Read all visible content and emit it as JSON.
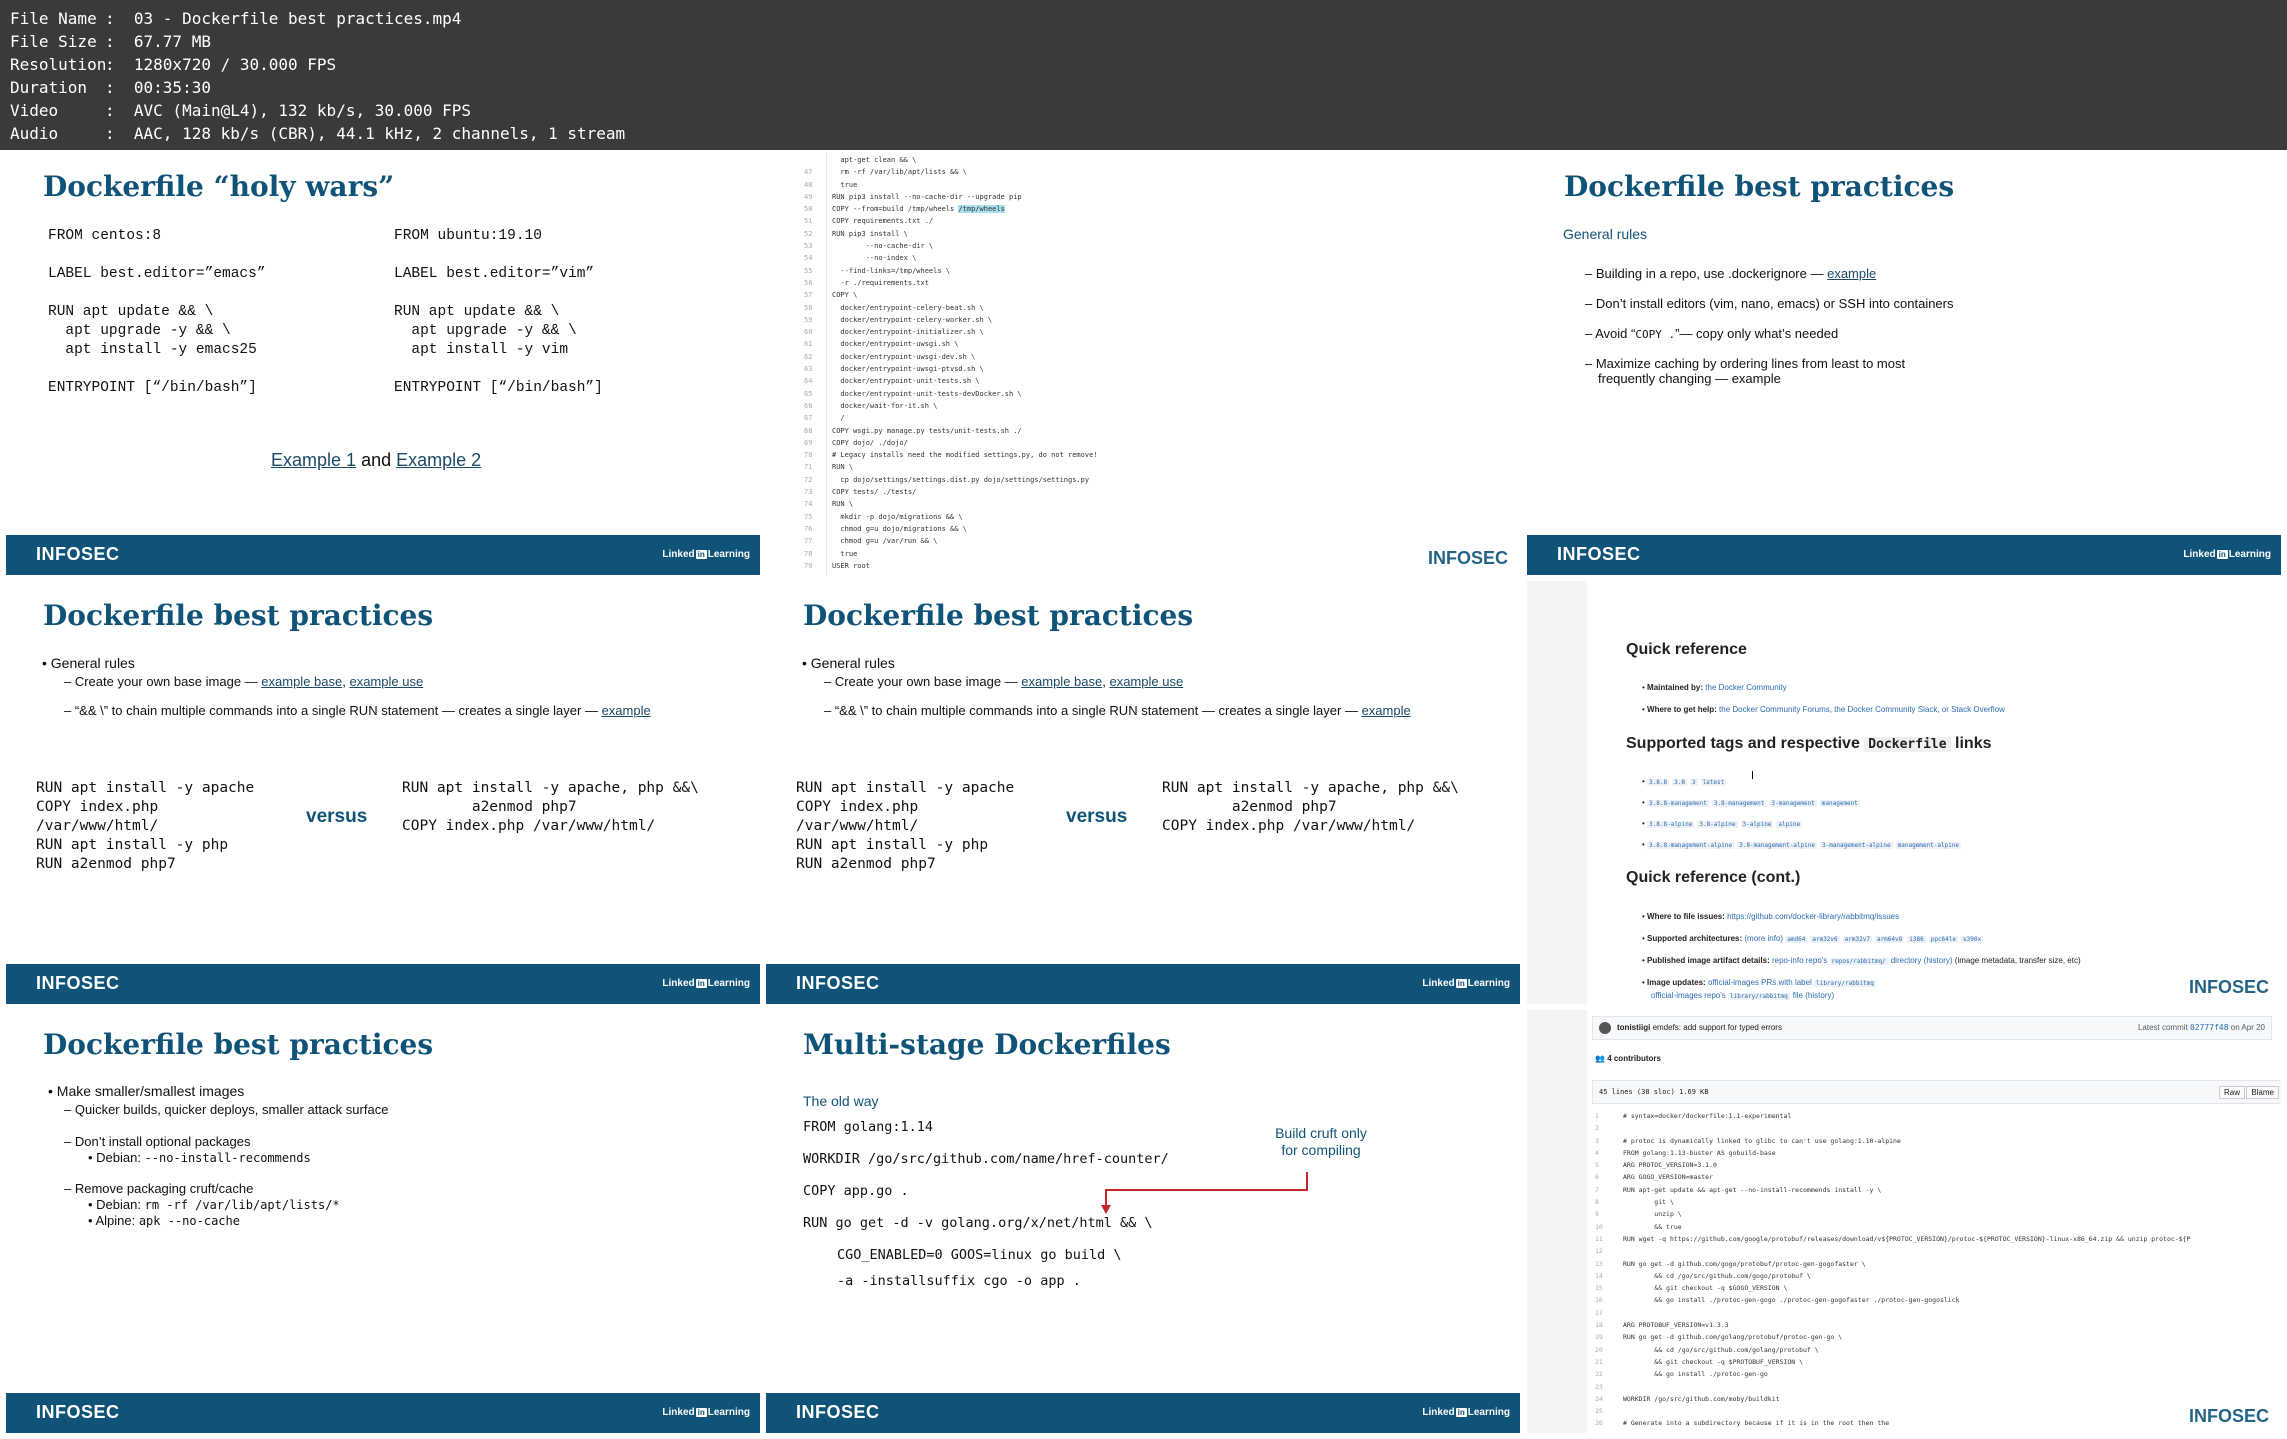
{
  "meta": [
    {
      "key": "File Name",
      "value": "03 - Dockerfile best practices.mp4"
    },
    {
      "key": "File Size",
      "value": "67.77 MB"
    },
    {
      "key": "Resolution",
      "value": "1280x720 / 30.000 FPS"
    },
    {
      "key": "Duration",
      "value": "00:35:30"
    },
    {
      "key": "Video",
      "value": "AVC (Main@L4), 132 kb/s, 30.000 FPS"
    },
    {
      "key": "Audio",
      "value": "AAC, 128 kb/s (CBR), 44.1 kHz, 2 channels, 1 stream"
    }
  ],
  "footer": {
    "brand": "INFOSEC",
    "linked": "Linked",
    "in": "in",
    "learning": "Learning"
  },
  "tile1": {
    "title": "Dockerfile “holy wars”",
    "left": "FROM centos:8\n\nLABEL best.editor=”emacs”\n\nRUN apt update && \\\n  apt upgrade -y && \\\n  apt install -y emacs25\n\nENTRYPOINT [“/bin/bash”]",
    "right": "FROM ubuntu:19.10\n\nLABEL best.editor=”vim”\n\nRUN apt update && \\\n  apt upgrade -y && \\\n  apt install -y vim\n\nENTRYPOINT [“/bin/bash”]",
    "link1": "Example 1",
    "and": "and",
    "link2": "Example 2"
  },
  "tile2": {
    "lines": [
      [
        "",
        "  apt-get clean && \\"
      ],
      [
        "47",
        "  rm -rf /var/lib/apt/lists && \\"
      ],
      [
        "48",
        "  true"
      ],
      [
        "49",
        "RUN pip3 install --no-cache-dir --upgrade pip"
      ],
      [
        "50",
        "COPY --from=build /tmp/wheels /tmp/wheels"
      ],
      [
        "51",
        "COPY requirements.txt ./"
      ],
      [
        "52",
        "RUN pip3 install \\"
      ],
      [
        "53",
        "        --no-cache-dir \\"
      ],
      [
        "54",
        "        --no-index \\"
      ],
      [
        "55",
        "  --find-links=/tmp/wheels \\"
      ],
      [
        "56",
        "  -r ./requirements.txt"
      ],
      [
        "57",
        "COPY \\"
      ],
      [
        "58",
        "  docker/entrypoint-celery-beat.sh \\"
      ],
      [
        "59",
        "  docker/entrypoint-celery-worker.sh \\"
      ],
      [
        "60",
        "  docker/entrypoint-initializer.sh \\"
      ],
      [
        "61",
        "  docker/entrypoint-uwsgi.sh \\"
      ],
      [
        "62",
        "  docker/entrypoint-uwsgi-dev.sh \\"
      ],
      [
        "63",
        "  docker/entrypoint-uwsgi-ptvsd.sh \\"
      ],
      [
        "64",
        "  docker/entrypoint-unit-tests.sh \\"
      ],
      [
        "65",
        "  docker/entrypoint-unit-tests-devDocker.sh \\"
      ],
      [
        "66",
        "  docker/wait-for-it.sh \\"
      ],
      [
        "67",
        "  /"
      ],
      [
        "68",
        "COPY wsgi.py manage.py tests/unit-tests.sh ./"
      ],
      [
        "69",
        "COPY dojo/ ./dojo/"
      ],
      [
        "70",
        "# Legacy installs need the modified settings.py, do not remove!"
      ],
      [
        "71",
        "RUN \\"
      ],
      [
        "72",
        "  cp dojo/settings/settings.dist.py dojo/settings/settings.py"
      ],
      [
        "73",
        "COPY tests/ ./tests/"
      ],
      [
        "74",
        "RUN \\"
      ],
      [
        "75",
        "  mkdir -p dojo/migrations && \\"
      ],
      [
        "76",
        "  chmod g=u dojo/migrations && \\"
      ],
      [
        "77",
        "  chmod g=u /var/run && \\"
      ],
      [
        "78",
        "  true"
      ],
      [
        "79",
        "USER root"
      ]
    ],
    "watermark": "INFOSEC"
  },
  "tile3": {
    "title": "Dockerfile best practices",
    "subtitle": "General rules",
    "b1": "Building in a repo, use .dockerignore — ",
    "b1link": "example",
    "b2": "Don’t install editors (vim, nano, emacs) or SSH into containers",
    "b3a": "Avoid “",
    "b3code": "COPY .",
    "b3b": "”— copy only what’s needed",
    "b4a": "Maximize caching by ordering lines from least to most",
    "b4b": "frequently changing — example"
  },
  "tile4": {
    "title": "Dockerfile best practices",
    "rules": "General rules",
    "r1": "Create your own base image — ",
    "r1l1": "example base",
    "r1sep": ", ",
    "r1l2": "example use",
    "r2": "“&& \\” to chain multiple commands into a single RUN statement — creates a single layer — ",
    "r2l": "example",
    "left": "RUN apt install -y apache\nCOPY index.php\n/var/www/html/\nRUN apt install -y php\nRUN a2enmod php7",
    "versus": "versus",
    "right": "RUN apt install -y apache, php &&\\\n        a2enmod php7\nCOPY index.php /var/www/html/"
  },
  "tile6": {
    "h1": "Quick reference",
    "m1k": "Maintained by:",
    "m1v": "the Docker Community",
    "m2k": "Where to get help:",
    "m2v": "the Docker Community Forums, the Docker Community Slack, or Stack Overflow",
    "h2a": "Supported tags and respective",
    "h2code": "Dockerfile",
    "h2b": "links",
    "tags1": [
      "3.8.8",
      "3.8",
      "3",
      "latest"
    ],
    "tags2": [
      "3.8.8-management",
      "3.8-management",
      "3-management",
      "management"
    ],
    "tags3": [
      "3.8.8-alpine",
      "3.8-alpine",
      "3-alpine",
      "alpine"
    ],
    "tags4": [
      "3.8.8-management-alpine",
      "3.8-management-alpine",
      "3-management-alpine",
      "management-alpine"
    ],
    "h3": "Quick reference (cont.)",
    "c1k": "Where to file issues:",
    "c1v": "https://github.com/docker-library/rabbitmq/issues",
    "c2k": "Supported architectures:",
    "c2v": "(more info)",
    "archs": [
      "amd64",
      "arm32v6",
      "arm32v7",
      "arm64v8",
      "i386",
      "ppc64le",
      "s390x"
    ],
    "c3k": "Published image artifact details:",
    "c3v": "repo-info repo's",
    "c3c": "repos/rabbitmq/",
    "c3w": "directory",
    "c3h": "(history)",
    "c3x": "(image metadata, transfer size, etc)",
    "c4k": "Image updates:",
    "c4v": "official-images PRs with label",
    "c4c": "library/rabbitmq",
    "c5v": "official-images repo's",
    "c5c": "library/rabbitmq",
    "c5w": "file",
    "c5h": "(history)",
    "watermark": "INFOSEC"
  },
  "tile7": {
    "title": "Dockerfile best practices",
    "b1": "Make smaller/smallest images",
    "b2": "Quicker builds, quicker deploys, smaller attack surface",
    "b3": "Don’t install optional packages",
    "b4a": "Debian: ",
    "b4c": "--no-install-recommends",
    "b5": "Remove packaging cruft/cache",
    "b6a": "Debian: ",
    "b6c": "rm -rf /var/lib/apt/lists/*",
    "b7a": "Alpine: ",
    "b7c": "apk --no-cache"
  },
  "tile8": {
    "title": "Multi-stage Dockerfiles",
    "sub": "The old way",
    "l1": "FROM golang:1.14",
    "l2": "WORKDIR /go/src/github.com/name/href-counter/",
    "l3": "COPY app.go .",
    "l4": "RUN go get -d -v golang.org/x/net/html && \\",
    "l5": "CGO_ENABLED=0 GOOS=linux go build \\",
    "l6": "-a -installsuffix cgo -o app .",
    "note1": "Build cruft only",
    "note2": "for compiling",
    "arrow_color": "#c0282d"
  },
  "tile9": {
    "user": "tonistiigi",
    "commit": "emdefs: add support for typed errors",
    "latest": "Latest commit",
    "hash": "02777f48",
    "date": "on Apr 20",
    "contributors": "4 contributors",
    "fileinfo": "45 lines (38 sloc)   1.69 KB",
    "raw": "Raw",
    "blame": "Blame",
    "lines": [
      [
        "1",
        "# syntax=docker/dockerfile:1.1-experimental"
      ],
      [
        "2",
        ""
      ],
      [
        "3",
        "# protoc is dynamically linked to glibc to can't use golang:1.10-alpine"
      ],
      [
        "4",
        "FROM golang:1.13-buster AS gobuild-base"
      ],
      [
        "5",
        "ARG PROTOC_VERSION=3.1.0"
      ],
      [
        "6",
        "ARG GOGO_VERSION=master"
      ],
      [
        "7",
        "RUN apt-get update && apt-get --no-install-recommends install -y \\"
      ],
      [
        "8",
        "        git \\"
      ],
      [
        "9",
        "        unzip \\"
      ],
      [
        "10",
        "        && true"
      ],
      [
        "11",
        "RUN wget -q https://github.com/google/protobuf/releases/download/v${PROTOC_VERSION}/protoc-${PROTOC_VERSION}-linux-x86_64.zip && unzip protoc-${P"
      ],
      [
        "12",
        ""
      ],
      [
        "13",
        "RUN go get -d github.com/gogo/protobuf/protoc-gen-gogofaster \\"
      ],
      [
        "14",
        "        && cd /go/src/github.com/gogo/protobuf \\"
      ],
      [
        "15",
        "        && git checkout -q $GOGO_VERSION \\"
      ],
      [
        "16",
        "        && go install ./protoc-gen-gogo ./protoc-gen-gogofaster ./protoc-gen-gogoslick"
      ],
      [
        "17",
        ""
      ],
      [
        "18",
        "ARG PROTOBUF_VERSION=v1.3.3"
      ],
      [
        "19",
        "RUN go get -d github.com/golang/protobuf/protoc-gen-go \\"
      ],
      [
        "20",
        "        && cd /go/src/github.com/golang/protobuf \\"
      ],
      [
        "21",
        "        && git checkout -q $PROTOBUF_VERSION \\"
      ],
      [
        "22",
        "        && go install ./protoc-gen-go"
      ],
      [
        "23",
        ""
      ],
      [
        "24",
        "WORKDIR /go/src/github.com/moby/buildkit"
      ],
      [
        "25",
        ""
      ],
      [
        "26",
        "# Generate into a subdirectory because if it is in the root then the"
      ]
    ],
    "watermark": "INFOSEC"
  }
}
